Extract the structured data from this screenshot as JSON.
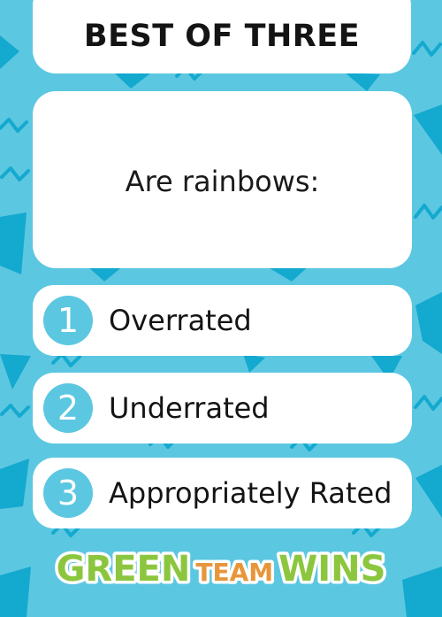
{
  "title": "BEST OF THREE",
  "question": "Are rainbows:",
  "options": [
    {
      "number": "1",
      "label": "Overrated"
    },
    {
      "number": "2",
      "label": "Underrated"
    },
    {
      "number": "3",
      "label": "Appropriately Rated"
    }
  ],
  "logo": "GREEN TEAM WINS",
  "colors": {
    "background": "#5cc7e1",
    "pattern_dark": "#14a9cf",
    "card": "#ffffff",
    "number_circle": "#5cc7e1",
    "logo_green": "#8cc63f",
    "logo_orange": "#e8963a"
  }
}
